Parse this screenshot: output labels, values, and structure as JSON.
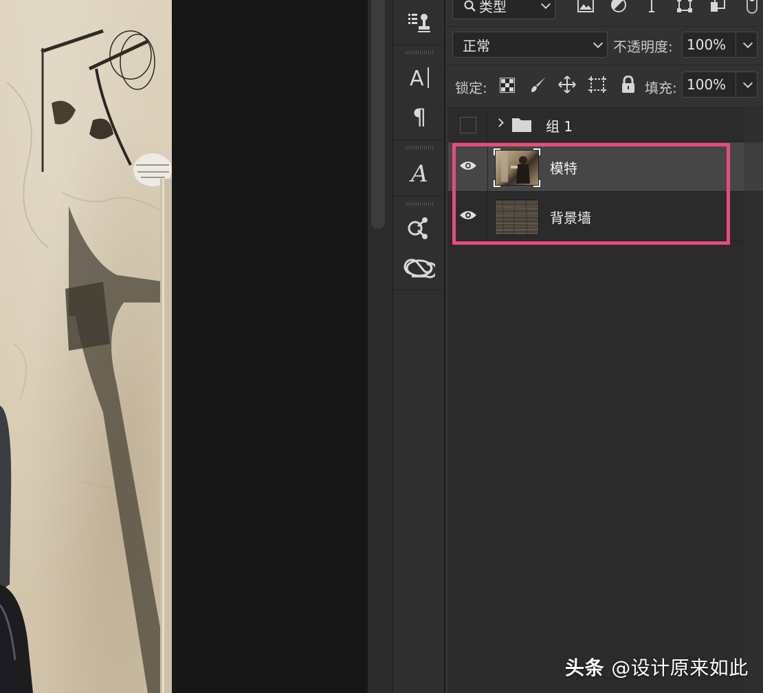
{
  "filter": {
    "kind_label": "类型"
  },
  "blend": {
    "mode": "正常",
    "opacity_label": "不透明度:",
    "opacity_value": "100%"
  },
  "lock": {
    "label": "锁定:",
    "fill_label": "填充:",
    "fill_value": "100%"
  },
  "layers": [
    {
      "name": "组 1",
      "type": "group",
      "visible": false
    },
    {
      "name": "模特",
      "type": "image",
      "visible": true,
      "selected": true
    },
    {
      "name": "背景墙",
      "type": "image",
      "visible": true,
      "selected": false
    }
  ],
  "watermark": {
    "brand": "头条",
    "handle": "@设计原来如此"
  },
  "colors": {
    "highlight": "#e94b7a",
    "panel": "#323232",
    "canvas": "#171717"
  }
}
